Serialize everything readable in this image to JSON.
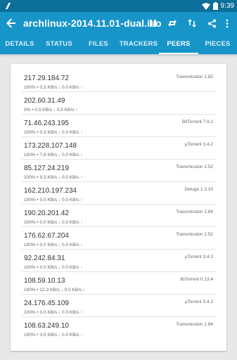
{
  "status_bar": {
    "time": "9:39"
  },
  "app_bar": {
    "title": "archlinux-2014.11.01-dual.iso"
  },
  "tabs": [
    "DETAILS",
    "STATUS",
    "FILES",
    "TRACKERS",
    "PEERS",
    "PIECES"
  ],
  "active_tab": "PEERS",
  "peers": [
    {
      "ip": "217.29.184.72",
      "progress": "100%",
      "down": "0.3 KB/s",
      "up": "0.0 KB/s",
      "client": "Transmission 2.82"
    },
    {
      "ip": "202.60.31.49",
      "progress": "0%",
      "down": "0.0 KB/s",
      "up": "0.0 KB/s",
      "client": ""
    },
    {
      "ip": "71.46.243.195",
      "progress": "100%",
      "down": "0.3 KB/s",
      "up": "0.0 KB/s",
      "client": "BitTorrent 7.9.2"
    },
    {
      "ip": "173.228.107.148",
      "progress": "100%",
      "down": "7.8 KB/s",
      "up": "0.0 KB/s",
      "client": "µTorrent 3.4.2"
    },
    {
      "ip": "85.127.24.219",
      "progress": "100%",
      "down": "9.3 KB/s",
      "up": "0.0 KB/s",
      "client": "Transmission 2.52"
    },
    {
      "ip": "162.210.197.234",
      "progress": "100%",
      "down": "0.0 KB/s",
      "up": "0.0 KB/s",
      "client": "Deluge 1.3.10"
    },
    {
      "ip": "190.20.201.42",
      "progress": "100%",
      "down": "0.0 KB/s",
      "up": "0.0 KB/s",
      "client": "Transmission 2.84"
    },
    {
      "ip": "176.62.67.204",
      "progress": "100%",
      "down": "0.0 KB/s",
      "up": "0.0 KB/s",
      "client": "Transmission 2.52"
    },
    {
      "ip": "92.242.84.31",
      "progress": "100%",
      "down": "0.0 KB/s",
      "up": "0.0 KB/s",
      "client": "µTorrent 3.4.2"
    },
    {
      "ip": "108.59.10.13",
      "progress": "100%",
      "down": "12.3 KB/s",
      "up": "0.0 KB/s",
      "client": "libTorrent 0.13.4"
    },
    {
      "ip": "24.176.45.109",
      "progress": "100%",
      "down": "0.0 KB/s",
      "up": "0.0 KB/s",
      "client": "µTorrent 3.4.2"
    },
    {
      "ip": "108.63.249.10",
      "progress": "100%",
      "down": "3.0 KB/s",
      "up": "0.0 KB/s",
      "client": "Transmission 2.84"
    }
  ],
  "icons": {
    "status_left": "notification-icon",
    "back": "arrow-left-icon",
    "pause": "pause-icon",
    "repeat": "repeat-icon",
    "sort": "swap-vert-icon",
    "share": "share-icon",
    "more": "more-vert-icon"
  },
  "colors": {
    "app_bar": "#1795c9",
    "status_bar": "#0b6f99",
    "background": "#e8e8e8"
  }
}
